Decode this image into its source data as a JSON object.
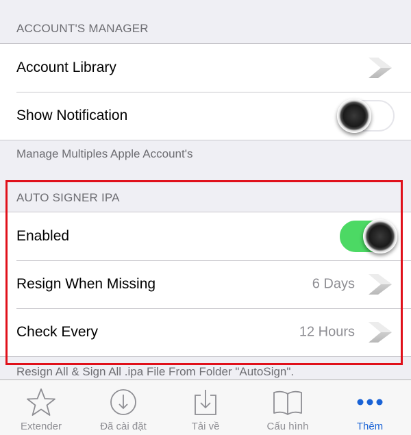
{
  "accounts_section": {
    "header": "ACCOUNT'S MANAGER",
    "rows": [
      {
        "label": "Account Library"
      },
      {
        "label": "Show Notification",
        "toggle": false
      }
    ],
    "footer": "Manage Multiples Apple Account's"
  },
  "auto_signer_section": {
    "header": "AUTO SIGNER IPA",
    "rows": [
      {
        "label": "Enabled",
        "toggle": true
      },
      {
        "label": "Resign When Missing",
        "detail": "6 Days"
      },
      {
        "label": "Check Every",
        "detail": "12 Hours"
      }
    ],
    "footer": "Resign All & Sign All .ipa File From Folder \"AutoSign\"."
  },
  "colors": {
    "toggle_on": "#4cd964",
    "highlight": "#e0101a",
    "tab_active": "#1a63d6",
    "tab_inactive": "#8e8e93"
  },
  "tabbar": {
    "tabs": [
      {
        "label": "Extender",
        "icon": "star-icon",
        "active": false
      },
      {
        "label": "Đã cài đặt",
        "icon": "download-circle-icon",
        "active": false
      },
      {
        "label": "Tải về",
        "icon": "tray-download-icon",
        "active": false
      },
      {
        "label": "Cấu hình",
        "icon": "book-icon",
        "active": false
      },
      {
        "label": "Thêm",
        "icon": "more-dots-icon",
        "active": true
      }
    ]
  }
}
